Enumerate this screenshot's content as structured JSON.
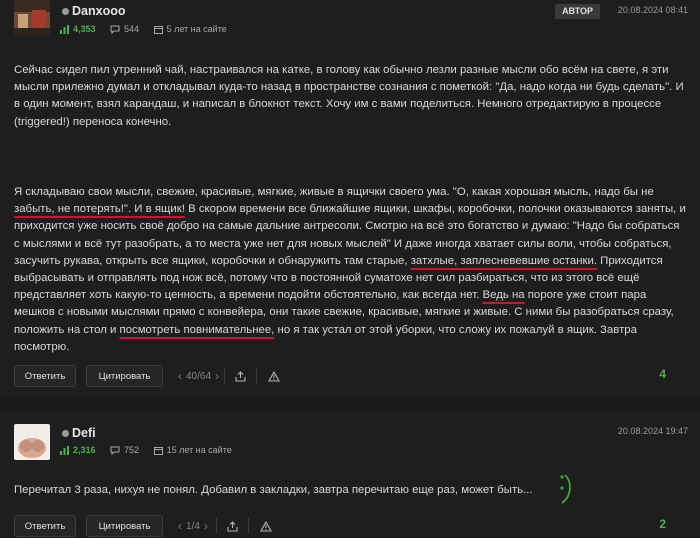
{
  "post1": {
    "username": "Danxooo",
    "rating": "4,353",
    "comments": "544",
    "membership": "5 лет на сайте",
    "badge": "АВТОР",
    "timestamp": "20.08.2024 08:41",
    "intro": "Сейчас сидел пил утренний чай, настраивался на катке, в голову как обычно лезли разные мысли обо всём на свете, я эти мысли прилежно думал и откладывал куда-то назад в пространстве сознания с пометкой: \"Да, надо когда ни будь сделать\". И в один момент, взял карандаш, и написал в блокнот текст. Хочу им с вами поделиться. Немного отредактирую в процессе (triggered!) переноса конечно.",
    "story": {
      "s1": "Я складываю свои мысли, свежие, красивые, мягкие, живые в ящички своего ума.  \"О, какая хорошая мысль, надо бы не ",
      "u1": "забыть, не потерять!\". И в ящик!",
      "s2": " В скором времени все ближайшие ящики, шкафы, коробочки, полочки оказываются заняты, и приходится уже носить своё добро на самые дальние антресоли. Смотрю на всё это богатство и думаю: \"Надо бы собраться с мыслями и всё тут разобрать, а то места уже нет для новых мыслей\" И даже иногда хватает силы воли, чтобы собраться, засучить рукава, открыть все ящики, коробочки и обнаружить там старые, ",
      "u2": "затхлые, заплесневевшие останки.",
      "s3": " Приходится выбрасывать и отправлять под нож всё,  потому что в постоянной суматохе нет сил разбираться, что из этого всё ещё представляет хоть какую-то ценность, а времени подойти обстоятельно, как всегда нет. ",
      "u3": "Ведь на",
      "s4": " пороге уже стоит пара мешков с новыми мыслями прямо с конвейера, они такие свежие, красивые, мягкие и живые. С ними бы разобраться сразу, положить на стол и ",
      "u4": "посмотреть повнимательнее,",
      "s5": " но я так устал от этой  уборки, что сложу их пожалуй в ящик. Завтра посмотрю."
    },
    "reply_label": "Ответить",
    "quote_label": "Цитировать",
    "pager": "40/64",
    "score": "4"
  },
  "post2": {
    "username": "Defi",
    "rating": "2,316",
    "comments": "752",
    "membership": "15 лет на сайте",
    "timestamp": "20.08.2024 19:47",
    "text": "Перечитал 3 раза, нихуя не понял. Добавил в закладки, завтра перечитаю еще раз, может быть...",
    "reply_label": "Ответить",
    "quote_label": "Цитировать",
    "pager": "1/4",
    "score": "2"
  }
}
